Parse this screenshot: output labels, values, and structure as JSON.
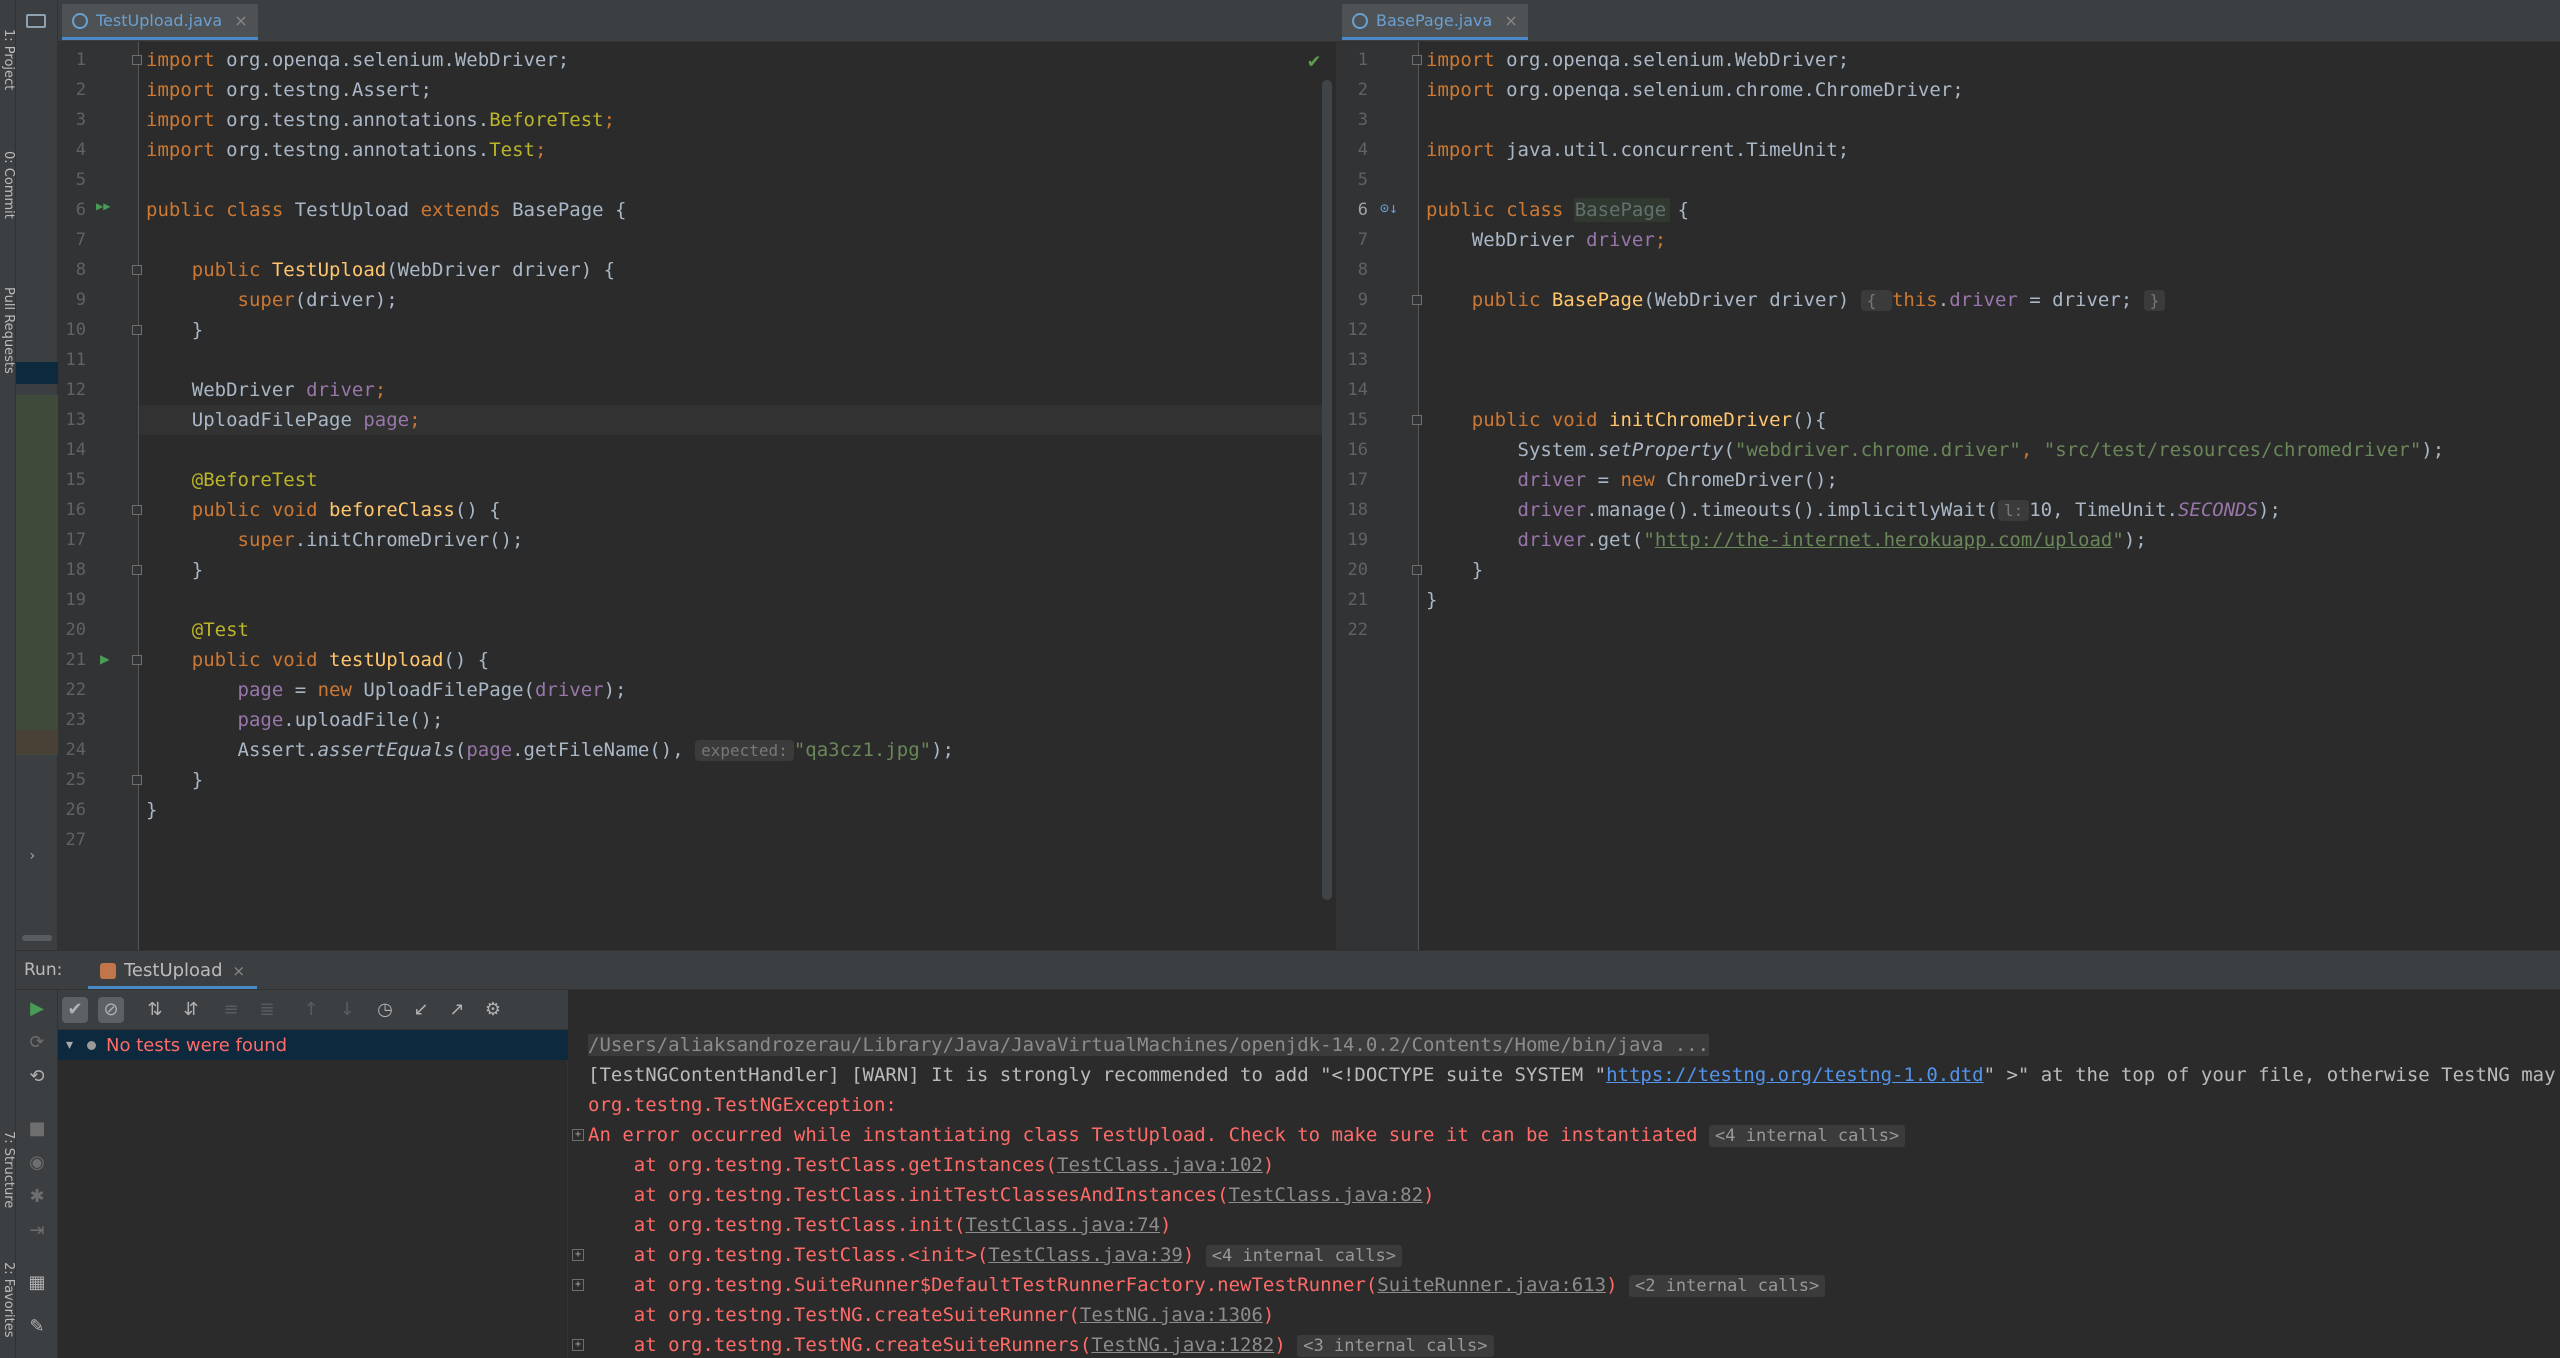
{
  "left_strip": {
    "project_label": "1: Project",
    "commit_label": "0: Commit",
    "pull_label": "Pull Requests",
    "structure_label": "7: Structure",
    "favorites_label": "2: Favorites"
  },
  "editor_left": {
    "tab": {
      "label": "TestUpload.java",
      "close": "×"
    },
    "line_numbers": [
      "1",
      "2",
      "3",
      "4",
      "5",
      "6",
      "7",
      "8",
      "9",
      "10",
      "11",
      "12",
      "13",
      "14",
      "15",
      "16",
      "17",
      "18",
      "19",
      "20",
      "21",
      "22",
      "23",
      "24",
      "25",
      "26",
      "27"
    ],
    "lines": {
      "l1": {
        "a": "import ",
        "b": "org.openqa.selenium.WebDriver;"
      },
      "l2": {
        "a": "import ",
        "b": "org.testng.Assert;"
      },
      "l3": {
        "a": "import ",
        "b": "org.testng.annotations.",
        "c": "BeforeTest",
        ";": ";"
      },
      "l4": {
        "a": "import ",
        "b": "org.testng.annotations.",
        "c": "Test",
        ";": ";"
      },
      "l6": {
        "a": "public class ",
        "b": "TestUpload ",
        "c": "extends ",
        "d": "BasePage {"
      },
      "l8": {
        "a": "    public ",
        "b": "TestUpload",
        "c": "(WebDriver driver) {"
      },
      "l9": {
        "a": "        super",
        "b": "(driver);"
      },
      "l10": "    }",
      "l12": {
        "a": "    WebDriver ",
        "b": "driver",
        ";": ";"
      },
      "l13": {
        "a": "    UploadFilePage ",
        "b": "page",
        ";": ";"
      },
      "l15": "    @BeforeTest",
      "l16": {
        "a": "    public void ",
        "b": "beforeClass",
        "c": "() {"
      },
      "l17": {
        "a": "        super",
        ".": ".initChromeDriver();"
      },
      "l18": "    }",
      "l20": "    @Test",
      "l21": {
        "a": "    public void ",
        "b": "testUpload",
        "c": "() {"
      },
      "l22": {
        "a": "        page",
        " = ": " = ",
        "new": "new ",
        "b": "UploadFilePage(",
        "c": "driver",
        ");": ");"
      },
      "l23": {
        "a": "        page",
        ".": ".uploadFile();"
      },
      "l24": {
        "a": "        Assert.",
        "b": "assertEquals",
        "c": "(",
        "d": "page",
        ".": ".getFileName(), ",
        "hint": "expected:",
        "e": "\"qa3cz1.jpg\"",
        "f": ");"
      },
      "l25": "    }",
      "l26": "}"
    },
    "status_check": "✔"
  },
  "editor_right": {
    "tab": {
      "label": "BasePage.java",
      "close": "×"
    },
    "line_numbers": [
      "1",
      "2",
      "3",
      "4",
      "5",
      "6",
      "7",
      "8",
      "9",
      "12",
      "13",
      "14",
      "15",
      "16",
      "17",
      "18",
      "19",
      "20",
      "21",
      "22"
    ],
    "lines": {
      "l1": {
        "a": "import ",
        "b": "org.openqa.selenium.WebDriver;"
      },
      "l2": {
        "a": "import ",
        "b": "org.openqa.selenium.chrome.ChromeDriver;"
      },
      "l4": {
        "a": "import ",
        "b": "java.util.concurrent.TimeUnit;"
      },
      "l6": {
        "a": "public class ",
        "b": "BasePage",
        " {": " {"
      },
      "l7": {
        "a": "    WebDriver ",
        "b": "driver",
        ";": ";"
      },
      "l9": {
        "a": "    public ",
        "b": "BasePage",
        "c": "(WebDriver driver) ",
        "d": "{ ",
        "e": "this",
        ".": ".",
        "f": "driver",
        " = driver; ": " = driver; ",
        "g": "}"
      },
      "l15": {
        "a": "    public void ",
        "b": "initChromeDriver",
        "c": "(){"
      },
      "l16": {
        "a": "        System.",
        "b": "setProperty",
        "c": "(",
        "d": "\"webdriver.chrome.driver\"",
        "e": ", ",
        "f": "\"src/test/resources/chromedriver\"",
        "g": ");"
      },
      "l17": {
        "a": "        driver",
        " = ": " = ",
        "new": "new ",
        "b": "ChromeDriver();"
      },
      "l18": {
        "a": "        driver",
        "b": ".manage().timeouts().implicitlyWait(",
        "hint": "l:",
        "c": "10",
        ", TimeUnit.": ", TimeUnit.",
        "d": "SECONDS",
        "e": ");"
      },
      "l19": {
        "a": "        driver",
        "b": ".get(",
        "q1": "\"",
        "url": "http://the-internet.herokuapp.com/upload",
        "q2": "\"",
        ");": ");"
      },
      "l20": "    }",
      "l21": "}"
    }
  },
  "run_panel": {
    "label": "Run:",
    "tab": {
      "label": "TestUpload",
      "close": "×"
    },
    "tree_status": "No tests were found",
    "console": {
      "l1": "/Users/aliaksandrozerau/Library/Java/JavaVirtualMachines/openjdk-14.0.2/Contents/Home/bin/java ...",
      "l2a": "[TestNGContentHandler] [WARN] It is strongly recommended to add \"<!DOCTYPE suite SYSTEM \"",
      "l2link": "https://testng.org/testng-1.0.dtd",
      "l2b": "\" >\" at the top of your file, otherwise TestNG may",
      "l3": "org.testng.TestNGException:",
      "l4": "An error occurred while instantiating class TestUpload. Check to make sure it can be instantiated",
      "l4ic": "<4 internal calls>",
      "s1a": "    at org.testng.TestClass.getInstances(",
      "s1l": "TestClass.java:102",
      "s1b": ")",
      "s2a": "    at org.testng.TestClass.initTestClassesAndInstances(",
      "s2l": "TestClass.java:82",
      "s2b": ")",
      "s3a": "    at org.testng.TestClass.init(",
      "s3l": "TestClass.java:74",
      "s3b": ")",
      "s4a": "    at org.testng.TestClass.<init>(",
      "s4l": "TestClass.java:39",
      "s4b": ")",
      "s4ic": "<4 internal calls>",
      "s5a": "    at org.testng.SuiteRunner$DefaultTestRunnerFactory.newTestRunner(",
      "s5l": "SuiteRunner.java:613",
      "s5b": ")",
      "s5ic": "<2 internal calls>",
      "s6a": "    at org.testng.TestNG.createSuiteRunner(",
      "s6l": "TestNG.java:1306",
      "s6b": ")",
      "s7a": "    at org.testng.TestNG.createSuiteRunners(",
      "s7l": "TestNG.java:1282",
      "s7b": ")",
      "s7ic": "<3 internal calls>"
    }
  },
  "colors": {
    "background": "#2b2b2b",
    "keyword": "#cc7832",
    "annotation": "#bbb529",
    "method": "#ffc66d",
    "field": "#9876aa",
    "string": "#6a8759",
    "error": "#ff6b68",
    "link": "#5394ec"
  }
}
